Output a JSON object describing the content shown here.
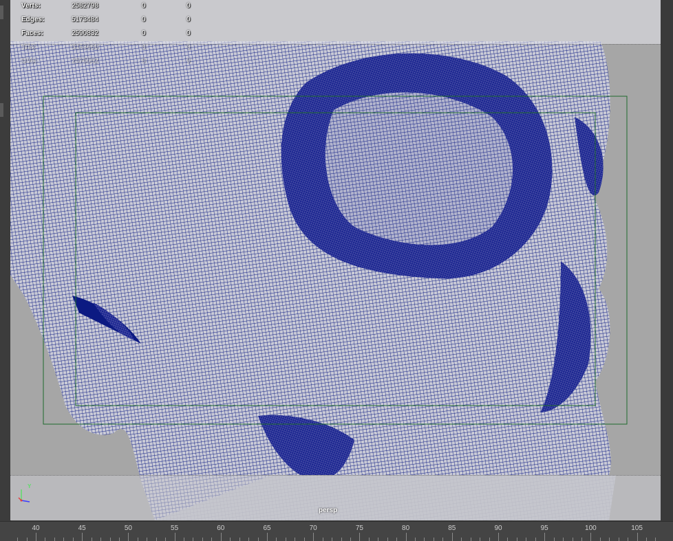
{
  "viewport": {
    "camera": "persp",
    "axis_label": "Y"
  },
  "hud": {
    "rows": [
      {
        "label": "Verts:",
        "value": "2582798",
        "selected": "0",
        "component": "0"
      },
      {
        "label": "Edges:",
        "value": "5173484",
        "selected": "0",
        "component": "0"
      },
      {
        "label": "Faces:",
        "value": "2590832",
        "selected": "0",
        "component": "0"
      },
      {
        "label": "Tris:",
        "value": "5163666",
        "selected": "0",
        "component": "0"
      },
      {
        "label": "UVs:",
        "value": "2575562",
        "selected": "0",
        "component": "0"
      }
    ]
  },
  "timeline": {
    "labels": [
      "40",
      "45",
      "50",
      "55",
      "60",
      "65",
      "70",
      "75",
      "80",
      "85",
      "90",
      "95",
      "100",
      "105"
    ]
  },
  "colors": {
    "viewport_bg": "#a6a6a6",
    "wireframe": "#0c1a82",
    "mesh_shade": "#c8c8d2",
    "gate": "#1f6b2c",
    "hud_text": "#ffffff"
  }
}
